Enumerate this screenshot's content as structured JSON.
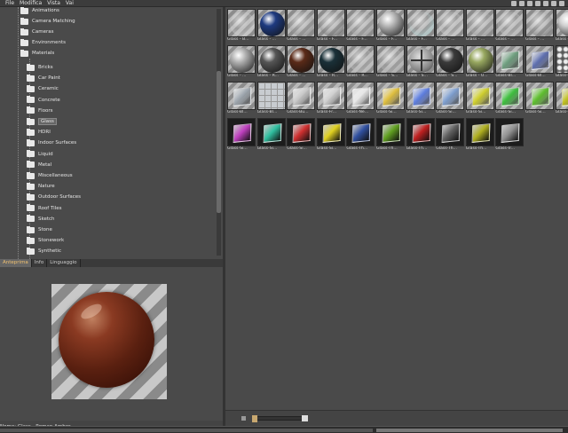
{
  "menu": [
    "File",
    "Modifica",
    "Vista",
    "Vai"
  ],
  "tree": {
    "top_items": [
      "Animations",
      "Camera Matching",
      "Cameras",
      "Environments",
      "Materials"
    ],
    "material_items": [
      "Bricks",
      "Car Paint",
      "Ceramic",
      "Concrete",
      "Floors",
      "Glass",
      "HDRI",
      "Indoor Surfaces",
      "Liquid",
      "Metal",
      "Miscellaneous",
      "Nature",
      "Outdoor Surfaces",
      "Roof Tiles",
      "Sketch",
      "Stone",
      "Stonework",
      "Synthetic"
    ],
    "selected": "Glass"
  },
  "tabs": [
    "Anteprima",
    "Info",
    "Linguaggio"
  ],
  "preview": {
    "name_label": "Nome: Glass - Roman Amber"
  },
  "tiles": [
    {
      "label": "Glass - B...",
      "kind": "ring",
      "color": "#c8c8c8"
    },
    {
      "label": "Glass - ...",
      "kind": "ball",
      "color": "#1e3a80"
    },
    {
      "label": "Glass - ...",
      "kind": "ring",
      "color": "#8a8a8a"
    },
    {
      "label": "Glass - F...",
      "kind": "ring",
      "color": "#6a6a6a"
    },
    {
      "label": "Glass - F...",
      "kind": "ring",
      "color": "#9a9a9a"
    },
    {
      "label": "Glass - F...",
      "kind": "ball",
      "color": "#b8b8b8"
    },
    {
      "label": "Glass - F...",
      "kind": "ring",
      "color": "#a8c8c8"
    },
    {
      "label": "Glass - ...",
      "kind": "ring",
      "color": "#c8c8c8"
    },
    {
      "label": "Glass - ...",
      "kind": "ring",
      "color": "#9a9a9a"
    },
    {
      "label": "Glass - ...",
      "kind": "ring",
      "color": "#bbbbbb"
    },
    {
      "label": "Glass - ...",
      "kind": "ring",
      "color": "#7a7a7a"
    },
    {
      "label": "Glass - ...",
      "kind": "ball",
      "color": "#d0d0d0"
    },
    {
      "label": "Glass - ...",
      "kind": "ball",
      "color": "#b0b0b0"
    },
    {
      "label": "Glass - R...",
      "kind": "ball",
      "color": "#555555"
    },
    {
      "label": "Glass - ...",
      "kind": "ball",
      "color": "#5a2a18"
    },
    {
      "label": "Glass - R...",
      "kind": "ball",
      "color": "#1a3038"
    },
    {
      "label": "Glass - R...",
      "kind": "ring",
      "color": "#b8b8b8"
    },
    {
      "label": "Glass - S...",
      "kind": "ring",
      "color": "#a8a8a8"
    },
    {
      "label": "Glass - S...",
      "kind": "cross",
      "color": "#888888"
    },
    {
      "label": "Glass - S...",
      "kind": "ball",
      "color": "#3a3a3a"
    },
    {
      "label": "Glass - U...",
      "kind": "ball",
      "color": "#98a860"
    },
    {
      "label": "Glass-Bl...",
      "kind": "cube",
      "color": "#70a080"
    },
    {
      "label": "Glass-Bl...",
      "kind": "cube",
      "color": "#6070b0"
    },
    {
      "label": "Glass-Bl...",
      "kind": "hex",
      "color": "#c0c0c0"
    },
    {
      "label": "Glass-Bl...",
      "kind": "cube",
      "color": "#a0a8b0"
    },
    {
      "label": "Glass-Bl...",
      "kind": "grid",
      "color": "#9098a0"
    },
    {
      "label": "Glass-Bu...",
      "kind": "cube",
      "color": "#c8c8c8"
    },
    {
      "label": "Glass-Fr...",
      "kind": "cube",
      "color": "#d0d0d0"
    },
    {
      "label": "Glass-Ne...",
      "kind": "cube",
      "color": "#e8e8e8"
    },
    {
      "label": "Glass-Si...",
      "kind": "cube",
      "color": "#e0c040"
    },
    {
      "label": "Glass-Si...",
      "kind": "cube",
      "color": "#6080e0"
    },
    {
      "label": "Glass-Si...",
      "kind": "cube",
      "color": "#80a0d0"
    },
    {
      "label": "Glass-Si...",
      "kind": "cube",
      "color": "#d0d030"
    },
    {
      "label": "Glass-Si...",
      "kind": "cube",
      "color": "#40c040"
    },
    {
      "label": "Glass-Si...",
      "kind": "cube",
      "color": "#60c030"
    },
    {
      "label": "Glass-Si...",
      "kind": "cube",
      "color": "#c0c020"
    },
    {
      "label": "Glass-Si...",
      "kind": "cube",
      "color": "#c040c0"
    },
    {
      "label": "Glass-Si...",
      "kind": "cube",
      "color": "#30c0a0"
    },
    {
      "label": "Glass-Si...",
      "kind": "cube",
      "color": "#d03030"
    },
    {
      "label": "Glass-Si...",
      "kind": "cube",
      "color": "#e0d020"
    },
    {
      "label": "Glass-Th...",
      "kind": "cube",
      "color": "#3050a0"
    },
    {
      "label": "Glass-Th...",
      "kind": "cube",
      "color": "#60a020"
    },
    {
      "label": "Glass-Th...",
      "kind": "cube",
      "color": "#c02020"
    },
    {
      "label": "Glass-Th...",
      "kind": "cube",
      "color": "#606060"
    },
    {
      "label": "Glass-Th...",
      "kind": "cube",
      "color": "#b0b020"
    },
    {
      "label": "Glass-Tr...",
      "kind": "cube",
      "color": "#909090"
    }
  ]
}
